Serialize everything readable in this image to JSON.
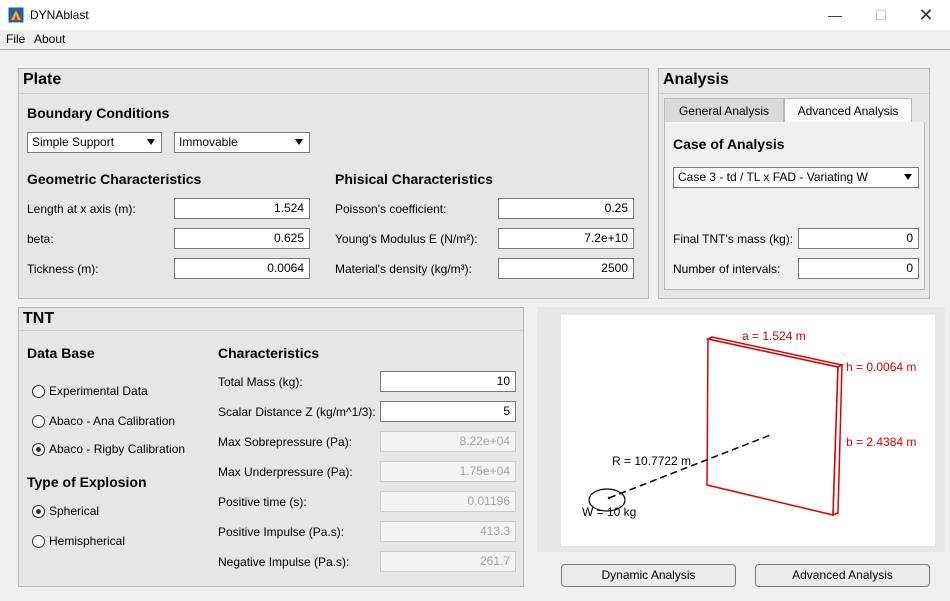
{
  "window": {
    "title": "DYNAblast"
  },
  "menu": {
    "file": "File",
    "about": "About"
  },
  "plate": {
    "title": "Plate",
    "boundary": {
      "heading": "Boundary Conditions",
      "support": "Simple Support",
      "mobility": "Immovable"
    },
    "geometric": {
      "heading": "Geometric Characteristics",
      "length_label": "Length at x axis (m):",
      "length_value": "1.524",
      "beta_label": "beta:",
      "beta_value": "0.625",
      "thickness_label": "Tickness (m):",
      "thickness_value": "0.0064"
    },
    "physical": {
      "heading": "Phisical Characteristics",
      "poisson_label": "Poisson's coefficient:",
      "poisson_value": "0.25",
      "young_label": "Young's Modulus E (N/m²):",
      "young_value": "7.2e+10",
      "density_label": "Material's density (kg/m³):",
      "density_value": "2500"
    }
  },
  "analysis": {
    "title": "Analysis",
    "tabs": [
      "General Analysis",
      "Advanced Analysis"
    ],
    "case_heading": "Case of Analysis",
    "case_value": "Case 3 - td / TL x FAD - Variating W",
    "final_mass_label": "Final TNT's mass (kg):",
    "final_mass_value": "0",
    "intervals_label": "Number of intervals:",
    "intervals_value": "0"
  },
  "tnt": {
    "title": "TNT",
    "database": {
      "heading": "Data Base",
      "options": [
        "Experimental Data",
        "Abaco - Ana Calibration",
        "Abaco - Rigby Calibration"
      ],
      "selected": 2
    },
    "explosion": {
      "heading": "Type of Explosion",
      "options": [
        "Spherical",
        "Hemispherical"
      ],
      "selected": 0
    },
    "characteristics": {
      "heading": "Characteristics",
      "total_mass_label": "Total Mass (kg):",
      "total_mass_value": "10",
      "scalar_label": "Scalar Distance Z (kg/m^1/3):",
      "scalar_value": "5",
      "max_sobre_label": "Max Sobrepressure (Pa):",
      "max_sobre_value": "8.22e+04",
      "max_under_label": "Max Underpressure (Pa):",
      "max_under_value": "1.75e+04",
      "pos_time_label": "Positive time (s):",
      "pos_time_value": "0.01196",
      "pos_impulse_label": "Positive Impulse (Pa.s):",
      "pos_impulse_value": "413.3",
      "neg_impulse_label": "Negative Impulse (Pa.s):",
      "neg_impulse_value": "261.7"
    }
  },
  "figure": {
    "a_label": "a = 1.524 m",
    "h_label": "h = 0.0064 m",
    "b_label": "b = 2.4384 m",
    "r_label": "R = 10.7722 m",
    "w_label": "W = 10 kg",
    "accent": "#e00000"
  },
  "buttons": {
    "dynamic": "Dynamic Analysis",
    "advanced": "Advanced Analysis"
  }
}
